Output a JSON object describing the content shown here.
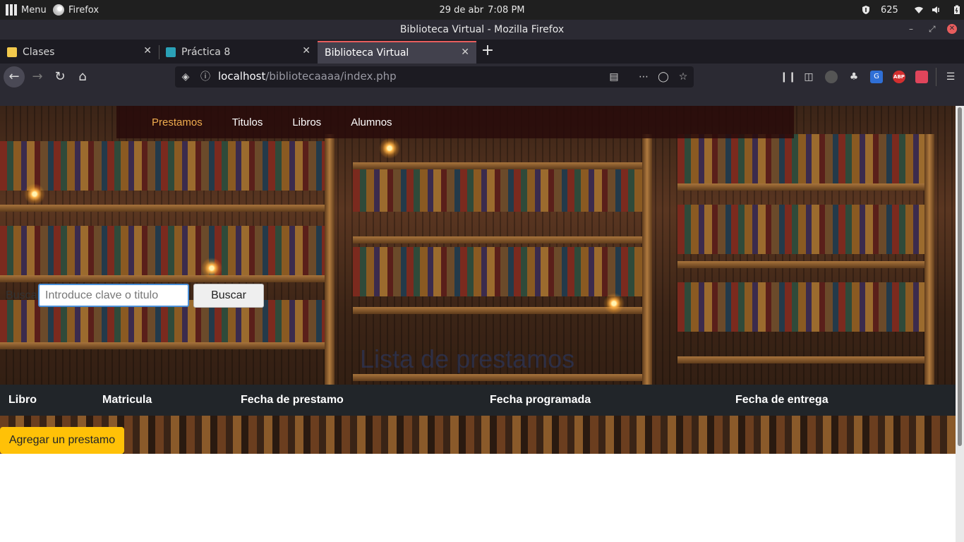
{
  "system_bar": {
    "menu_label": "Menu",
    "app_label": "Firefox",
    "date": "29 de abr",
    "time": "7:08 PM",
    "tray_count": "625"
  },
  "window": {
    "title": "Biblioteca Virtual - Mozilla Firefox"
  },
  "tabs": [
    {
      "label": "Clases",
      "favicon_color": "#f2c94c"
    },
    {
      "label": "Práctica 8",
      "favicon_color": "#2aa1b7"
    },
    {
      "label": "Biblioteca Virtual",
      "active": true
    }
  ],
  "url": {
    "host": "localhost",
    "path": "/bibliotecaaaa/index.php"
  },
  "site": {
    "nav": [
      "Prestamos",
      "Titulos",
      "Libros",
      "Alumnos"
    ],
    "search_label": "Buscar",
    "search_placeholder": "Introduce clave o titulo",
    "search_button": "Buscar",
    "page_title": "Lista de prestamos",
    "table_headers": [
      "Libro",
      "Matricula",
      "Fecha de prestamo",
      "Fecha programada",
      "Fecha de entrega"
    ],
    "add_button": "Agregar un prestamo"
  },
  "colors": {
    "nav_active": "#f0ad4e",
    "add_button": "#ffc107",
    "table_header_bg": "#212529",
    "tab_accent": "#e85d5d"
  }
}
